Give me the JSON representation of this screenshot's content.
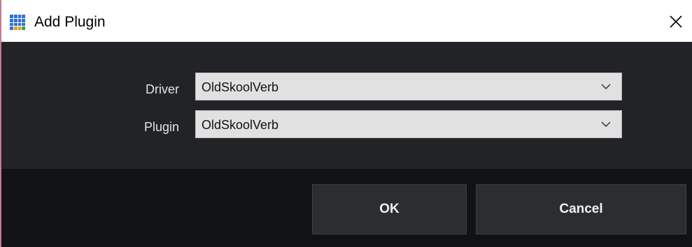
{
  "window": {
    "title": "Add Plugin",
    "icon": "app-grid-icon",
    "close_icon": "close-icon"
  },
  "form": {
    "driver": {
      "label": "Driver",
      "selected": "OldSkoolVerb"
    },
    "plugin": {
      "label": "Plugin",
      "selected": "OldSkoolVerb"
    }
  },
  "buttons": {
    "ok_label": "OK",
    "cancel_label": "Cancel"
  },
  "colors": {
    "main_panel": "#222326",
    "footer_panel": "#111214",
    "button": "#2b2d31",
    "select_bg": "#e1e1e1",
    "accent_border": "#c8788f"
  }
}
